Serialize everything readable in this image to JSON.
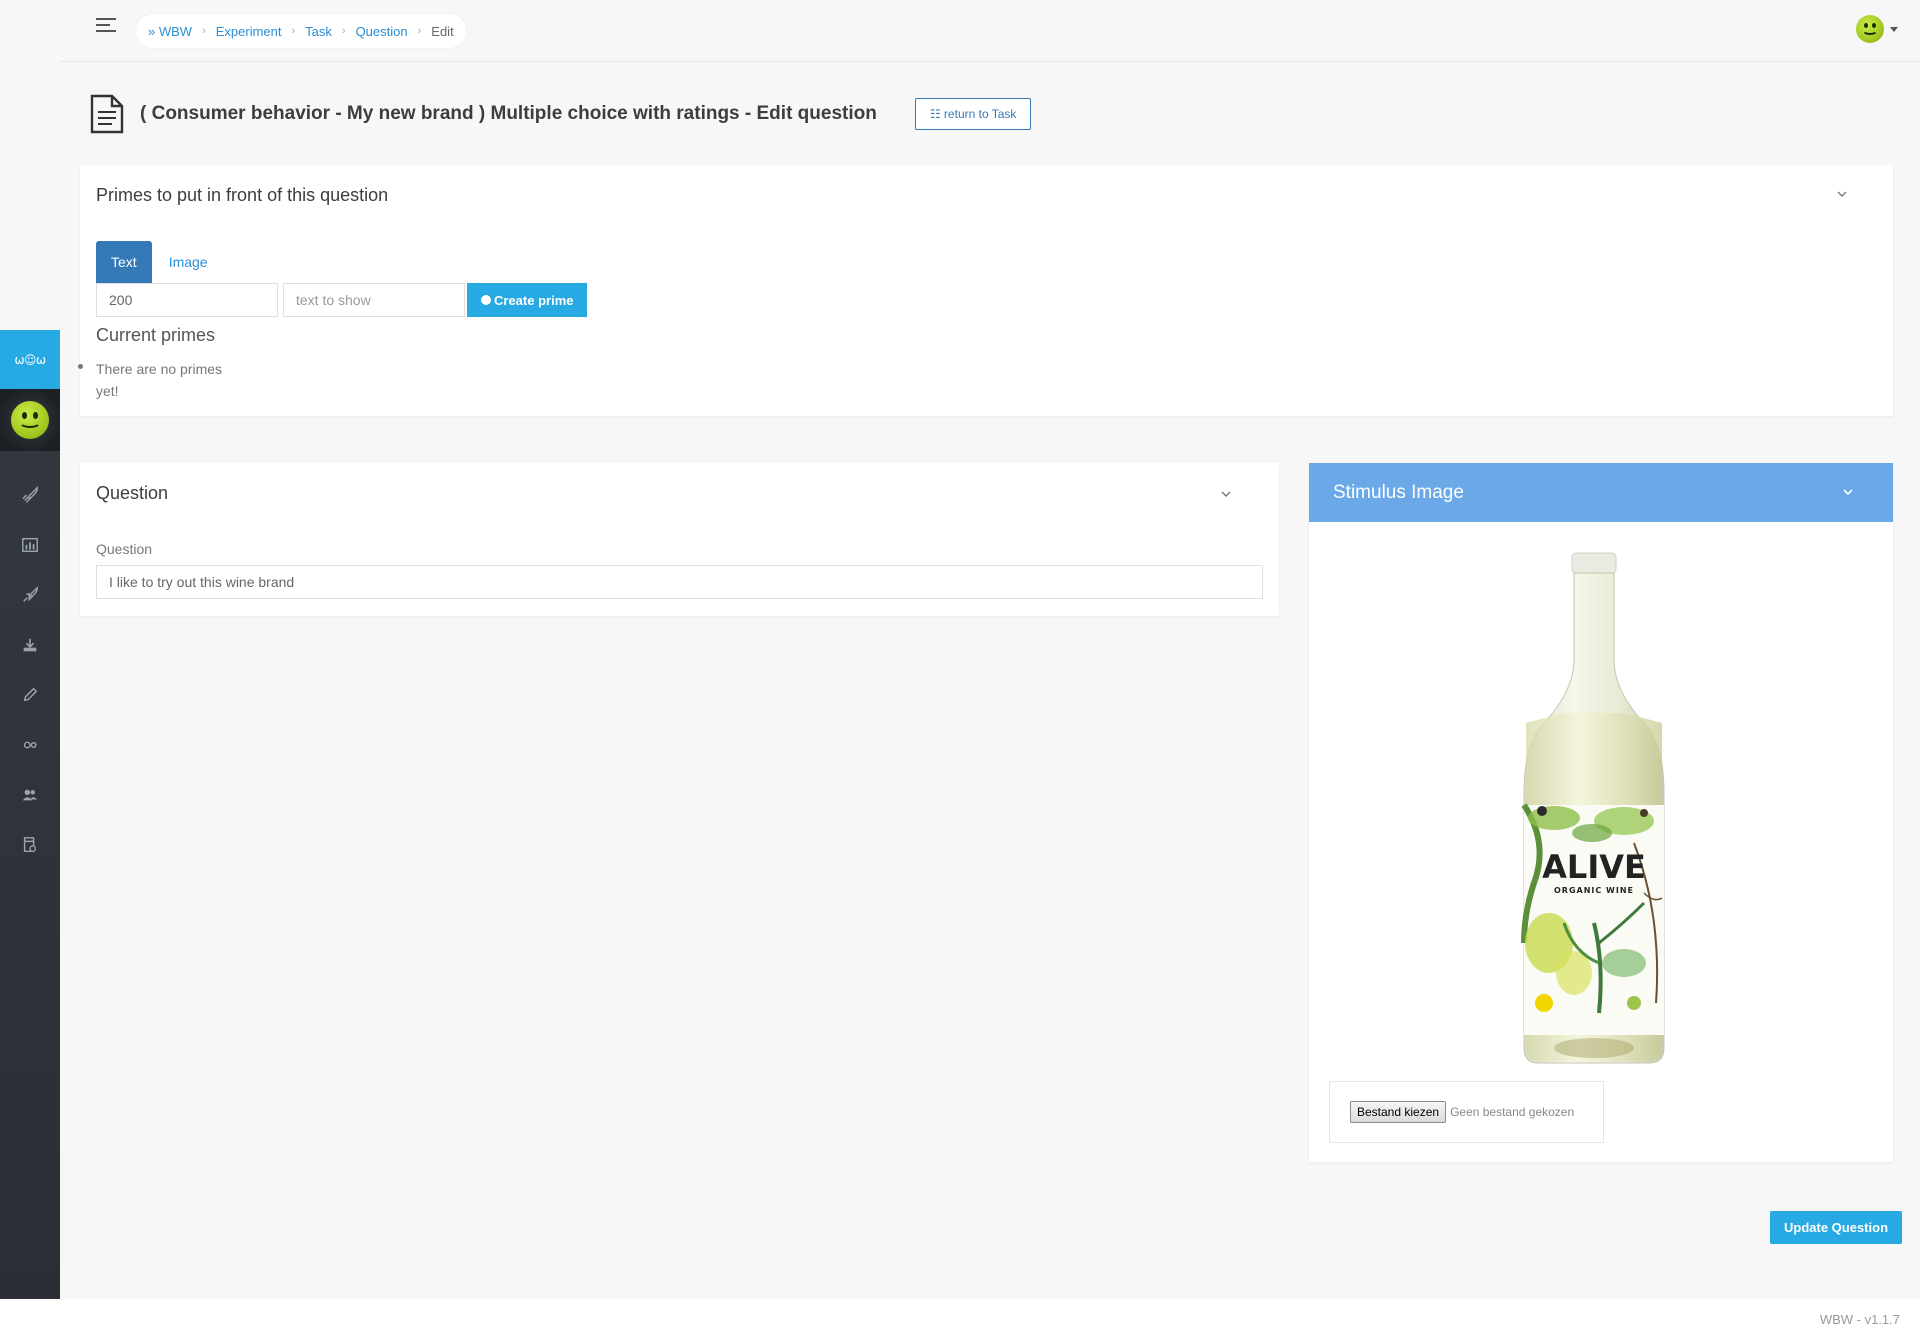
{
  "sidebar": {
    "brand": "ω☺ω",
    "icons": [
      "rocket-icon",
      "bar-chart-icon",
      "rocket-alt-icon",
      "download-icon",
      "pencil-icon",
      "gears-icon",
      "users-icon",
      "document-settings-icon"
    ]
  },
  "breadcrumb": {
    "items": [
      "» WBW",
      "Experiment",
      "Task",
      "Question"
    ],
    "current": "Edit"
  },
  "header": {
    "title": "( Consumer behavior - My new brand ) Multiple choice with ratings - Edit question",
    "return_button": "☷ return to Task"
  },
  "primes": {
    "title": "Primes to put in front of this question",
    "tabs": [
      "Text",
      "Image"
    ],
    "duration_value": "200",
    "text_placeholder": "text to show",
    "create_button": "Create prime",
    "current_title": "Current primes",
    "empty_message": "There are no primes yet!"
  },
  "question": {
    "title": "Question",
    "field_label": "Question",
    "field_value": "I like to try out this wine brand"
  },
  "stimulus": {
    "title": "Stimulus Image",
    "label_brand": "ALIVE",
    "label_sub": "ORGANIC WINE",
    "file_button": "Bestand kiezen",
    "file_status": "Geen bestand gekozen"
  },
  "actions": {
    "update_button": "Update Question"
  },
  "footer": {
    "version": "WBW - v1.1.7"
  },
  "colors": {
    "accent": "#27a9e3",
    "primary": "#337ab7",
    "stimulus_header": "#6aa8e8",
    "sidebar": "#2f343a"
  }
}
